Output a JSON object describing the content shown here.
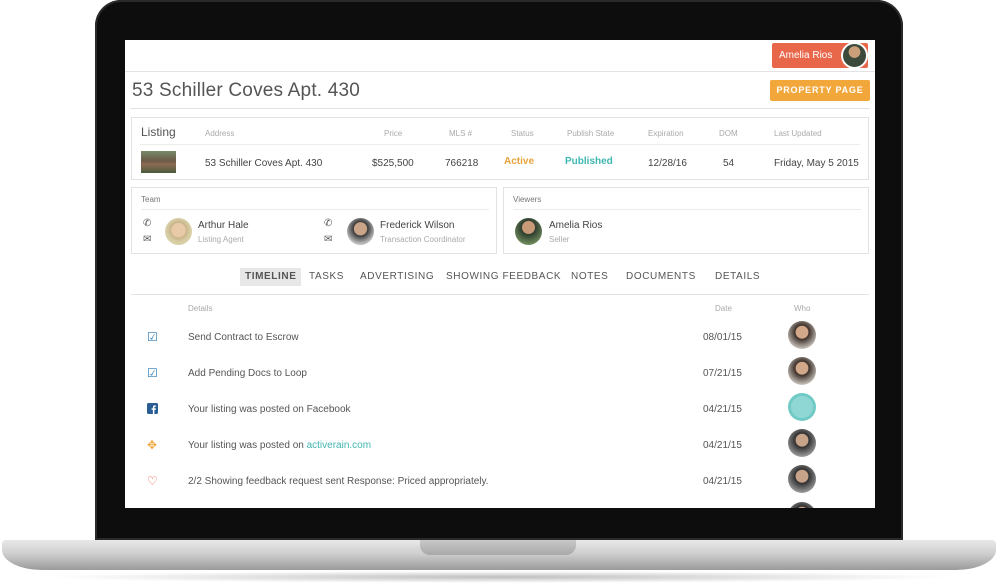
{
  "header": {
    "user_name": "Amelia Rios",
    "page_title": "53 Schiller Coves Apt. 430",
    "property_button": "PROPERTY PAGE"
  },
  "listing": {
    "label": "Listing",
    "columns": [
      "Address",
      "Price",
      "MLS #",
      "Status",
      "Publish State",
      "Expiration",
      "DOM",
      "Last Updated"
    ],
    "row": {
      "address": "53 Schiller Coves Apt. 430",
      "price": "$525,500",
      "mls": "766218",
      "status": "Active",
      "publish_state": "Published",
      "expiration": "12/28/16",
      "dom": "54",
      "last_updated": "Friday, May 5 2015"
    }
  },
  "team": {
    "title": "Team",
    "members": [
      {
        "name": "Arthur Hale",
        "role": "Listing Agent"
      },
      {
        "name": "Frederick Wilson",
        "role": "Transaction Coordinator"
      }
    ]
  },
  "viewers": {
    "title": "Viewers",
    "members": [
      {
        "name": "Amelia Rios",
        "role": "Seller"
      }
    ]
  },
  "tabs": [
    "TIMELINE",
    "TASKS",
    "ADVERTISING",
    "SHOWING FEEDBACK",
    "NOTES",
    "DOCUMENTS",
    "DETAILS"
  ],
  "timeline": {
    "columns": {
      "details": "Details",
      "date": "Date",
      "who": "Who"
    },
    "rows": [
      {
        "icon": "checkbox-icon",
        "details": "Send Contract to Escrow",
        "date": "08/01/15"
      },
      {
        "icon": "checkbox-icon",
        "details": "Add Pending Docs to Loop",
        "date": "07/21/15"
      },
      {
        "icon": "facebook-icon",
        "details": "Your listing was posted on Facebook",
        "date": "04/21/15"
      },
      {
        "icon": "move-icon",
        "details": "Your listing was posted on ",
        "link": "activerain.com",
        "date": "04/21/15"
      },
      {
        "icon": "heart-icon",
        "details": "2/2 Showing feedback request sent Response: Priced appropriately.",
        "date": "04/21/15"
      }
    ]
  },
  "colors": {
    "user_chip": "#e8674b",
    "property_button": "#f2a73b",
    "status_active": "#e8a33b",
    "status_published": "#3fb6b1",
    "link": "#3fb6b1"
  }
}
